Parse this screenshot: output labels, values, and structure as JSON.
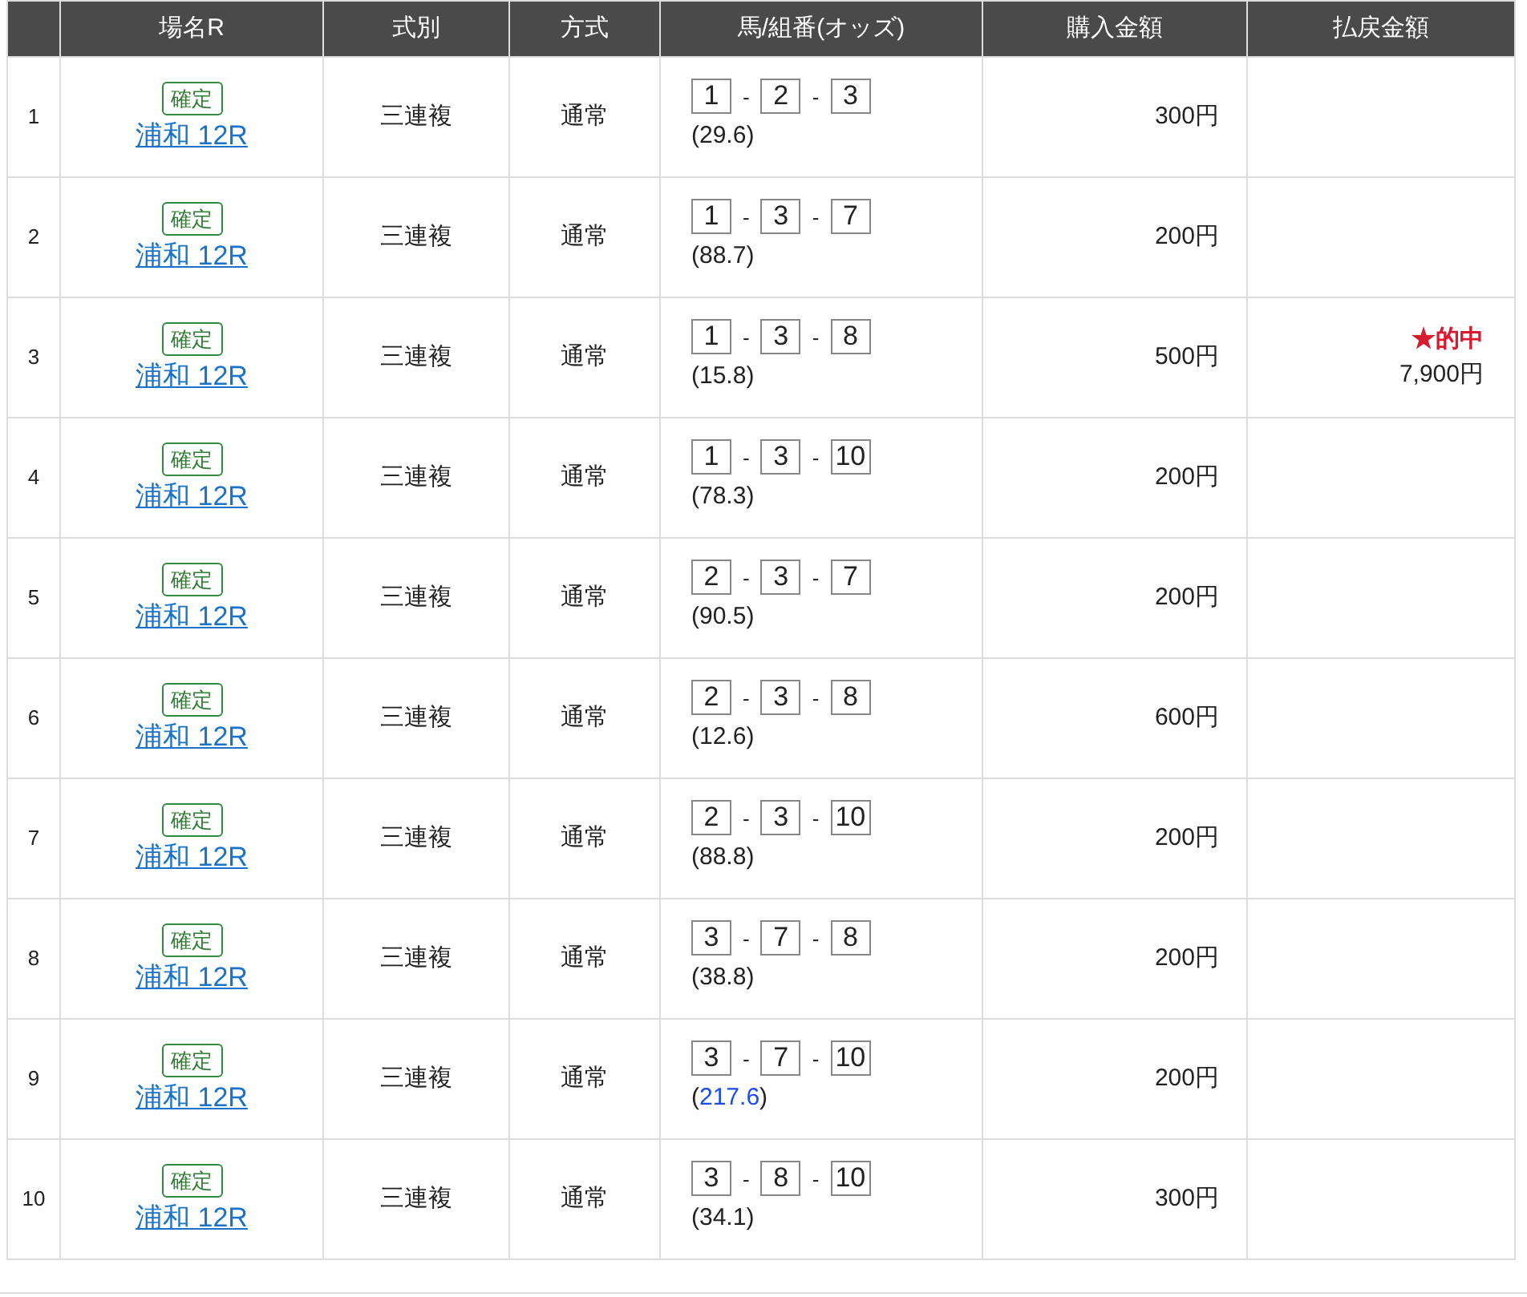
{
  "table": {
    "columns": [
      "",
      "場名R",
      "式別",
      "方式",
      "馬/組番(オッズ)",
      "購入金額",
      "払戻金額"
    ],
    "rows": [
      {
        "no": "1",
        "status": "確定",
        "race": "浦和 12R",
        "type": "三連複",
        "method": "通常",
        "horses": [
          "1",
          "2",
          "3"
        ],
        "separator": "-",
        "odds": {
          "open": "(",
          "value": "29.6",
          "close": ")",
          "high": false
        },
        "amount": "300円"
      },
      {
        "no": "2",
        "status": "確定",
        "race": "浦和 12R",
        "type": "三連複",
        "method": "通常",
        "horses": [
          "1",
          "3",
          "7"
        ],
        "separator": "-",
        "odds": {
          "open": "(",
          "value": "88.7",
          "close": ")",
          "high": false
        },
        "amount": "200円"
      },
      {
        "no": "3",
        "status": "確定",
        "race": "浦和 12R",
        "type": "三連複",
        "method": "通常",
        "horses": [
          "1",
          "3",
          "8"
        ],
        "separator": "-",
        "odds": {
          "open": "(",
          "value": "15.8",
          "close": ")",
          "high": false
        },
        "amount": "500円",
        "payout": {
          "label": "★的中",
          "amount": "7,900円"
        }
      },
      {
        "no": "4",
        "status": "確定",
        "race": "浦和 12R",
        "type": "三連複",
        "method": "通常",
        "horses": [
          "1",
          "3",
          "10"
        ],
        "separator": "-",
        "odds": {
          "open": "(",
          "value": "78.3",
          "close": ")",
          "high": false
        },
        "amount": "200円"
      },
      {
        "no": "5",
        "status": "確定",
        "race": "浦和 12R",
        "type": "三連複",
        "method": "通常",
        "horses": [
          "2",
          "3",
          "7"
        ],
        "separator": "-",
        "odds": {
          "open": "(",
          "value": "90.5",
          "close": ")",
          "high": false
        },
        "amount": "200円"
      },
      {
        "no": "6",
        "status": "確定",
        "race": "浦和 12R",
        "type": "三連複",
        "method": "通常",
        "horses": [
          "2",
          "3",
          "8"
        ],
        "separator": "-",
        "odds": {
          "open": "(",
          "value": "12.6",
          "close": ")",
          "high": false
        },
        "amount": "600円"
      },
      {
        "no": "7",
        "status": "確定",
        "race": "浦和 12R",
        "type": "三連複",
        "method": "通常",
        "horses": [
          "2",
          "3",
          "10"
        ],
        "separator": "-",
        "odds": {
          "open": "(",
          "value": "88.8",
          "close": ")",
          "high": false
        },
        "amount": "200円"
      },
      {
        "no": "8",
        "status": "確定",
        "race": "浦和 12R",
        "type": "三連複",
        "method": "通常",
        "horses": [
          "3",
          "7",
          "8"
        ],
        "separator": "-",
        "odds": {
          "open": "(",
          "value": "38.8",
          "close": ")",
          "high": false
        },
        "amount": "200円"
      },
      {
        "no": "9",
        "status": "確定",
        "race": "浦和 12R",
        "type": "三連複",
        "method": "通常",
        "horses": [
          "3",
          "7",
          "10"
        ],
        "separator": "-",
        "odds": {
          "open": "(",
          "value": "217.6",
          "close": ")",
          "high": true
        },
        "amount": "200円"
      },
      {
        "no": "10",
        "status": "確定",
        "race": "浦和 12R",
        "type": "三連複",
        "method": "通常",
        "horses": [
          "3",
          "8",
          "10"
        ],
        "separator": "-",
        "odds": {
          "open": "(",
          "value": "34.1",
          "close": ")",
          "high": false
        },
        "amount": "300円"
      }
    ]
  }
}
